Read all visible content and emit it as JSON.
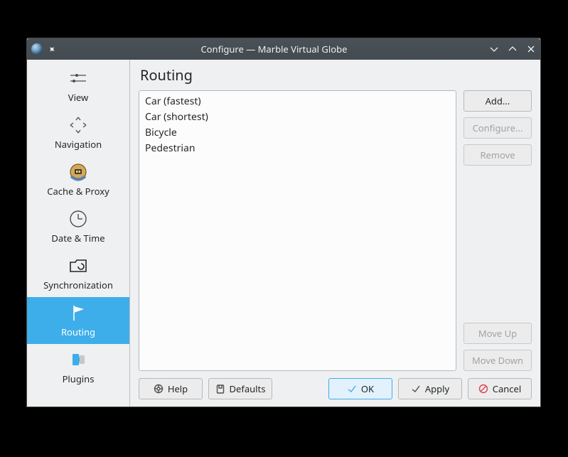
{
  "window": {
    "title": "Configure — Marble Virtual Globe"
  },
  "sidebar": {
    "items": [
      {
        "label": "View"
      },
      {
        "label": "Navigation"
      },
      {
        "label": "Cache & Proxy"
      },
      {
        "label": "Date & Time"
      },
      {
        "label": "Synchronization"
      },
      {
        "label": "Routing"
      },
      {
        "label": "Plugins"
      }
    ]
  },
  "main": {
    "title": "Routing",
    "profiles": [
      "Car (fastest)",
      "Car (shortest)",
      "Bicycle",
      "Pedestrian"
    ]
  },
  "buttons": {
    "add": "Add...",
    "configure": "Configure...",
    "remove": "Remove",
    "moveup": "Move Up",
    "movedown": "Move Down",
    "help": "Help",
    "defaults": "Defaults",
    "ok": "OK",
    "apply": "Apply",
    "cancel": "Cancel"
  }
}
